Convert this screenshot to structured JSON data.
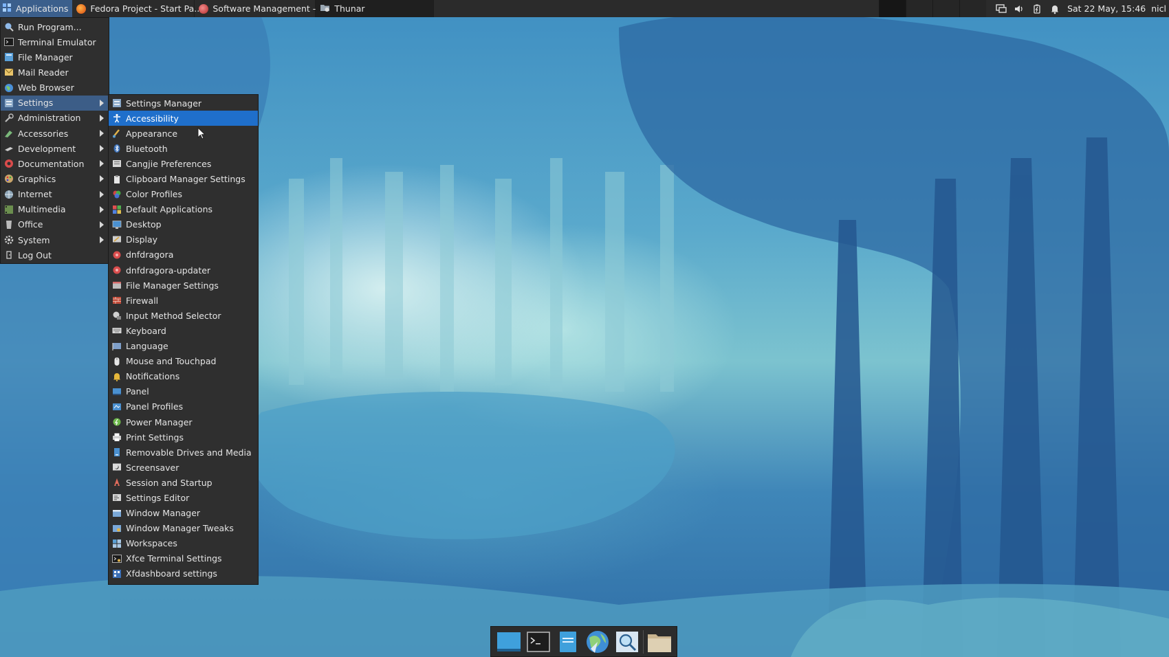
{
  "top_panel": {
    "applications_label": "Applications",
    "tasks": [
      {
        "title": "Fedora Project - Start Pa..."
      },
      {
        "title": "Software Management -..."
      },
      {
        "title": "Thunar"
      }
    ],
    "clock": "Sat 22 May, 15:46",
    "user": "nicl"
  },
  "main_menu": {
    "items": [
      {
        "label": "Run Program..."
      },
      {
        "label": "Terminal Emulator"
      },
      {
        "label": "File Manager"
      },
      {
        "label": "Mail Reader"
      },
      {
        "label": "Web Browser"
      },
      {
        "label": "Settings"
      },
      {
        "label": "Administration"
      },
      {
        "label": "Accessories"
      },
      {
        "label": "Development"
      },
      {
        "label": "Documentation"
      },
      {
        "label": "Graphics"
      },
      {
        "label": "Internet"
      },
      {
        "label": "Multimedia"
      },
      {
        "label": "Office"
      },
      {
        "label": "System"
      },
      {
        "label": "Log Out"
      }
    ]
  },
  "settings_submenu": {
    "items": [
      {
        "label": "Settings Manager"
      },
      {
        "label": "Accessibility"
      },
      {
        "label": "Appearance"
      },
      {
        "label": "Bluetooth"
      },
      {
        "label": "Cangjie Preferences"
      },
      {
        "label": "Clipboard Manager Settings"
      },
      {
        "label": "Color Profiles"
      },
      {
        "label": "Default Applications"
      },
      {
        "label": "Desktop"
      },
      {
        "label": "Display"
      },
      {
        "label": "dnfdragora"
      },
      {
        "label": "dnfdragora-updater"
      },
      {
        "label": "File Manager Settings"
      },
      {
        "label": "Firewall"
      },
      {
        "label": "Input Method Selector"
      },
      {
        "label": "Keyboard"
      },
      {
        "label": "Language"
      },
      {
        "label": "Mouse and Touchpad"
      },
      {
        "label": "Notifications"
      },
      {
        "label": "Panel"
      },
      {
        "label": "Panel Profiles"
      },
      {
        "label": "Power Manager"
      },
      {
        "label": "Print Settings"
      },
      {
        "label": "Removable Drives and Media"
      },
      {
        "label": "Screensaver"
      },
      {
        "label": "Session and Startup"
      },
      {
        "label": "Settings Editor"
      },
      {
        "label": "Window Manager"
      },
      {
        "label": "Window Manager Tweaks"
      },
      {
        "label": "Workspaces"
      },
      {
        "label": "Xfce Terminal Settings"
      },
      {
        "label": "Xfdashboard settings"
      }
    ]
  },
  "colors": {
    "panel_bg": "#2b2b2b",
    "menu_bg": "#2f2f2f",
    "highlight": "#1f6fcb",
    "open_parent": "#3c5d87"
  }
}
